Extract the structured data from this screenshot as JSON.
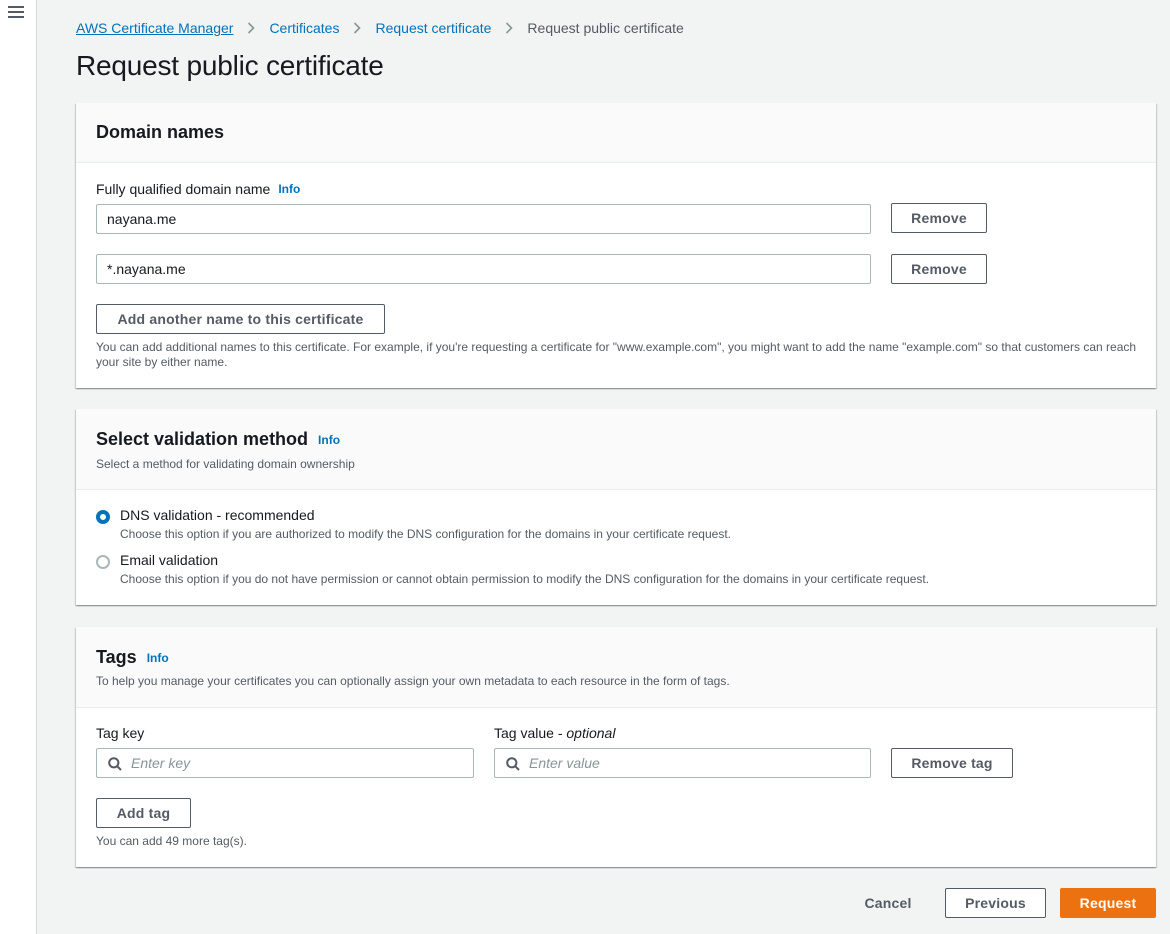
{
  "breadcrumb": {
    "items": [
      "AWS Certificate Manager",
      "Certificates",
      "Request certificate"
    ],
    "current": "Request public certificate"
  },
  "page": {
    "title": "Request public certificate"
  },
  "domain_names": {
    "title": "Domain names",
    "field_label": "Fully qualified domain name",
    "info": "Info",
    "values": [
      "nayana.me",
      "*.nayana.me"
    ],
    "remove_label": "Remove",
    "add_button": "Add another name to this certificate",
    "help_text": "You can add additional names to this certificate. For example, if you're requesting a certificate for \"www.example.com\", you might want to add the name \"example.com\" so that customers can reach your site by either name."
  },
  "validation": {
    "title": "Select validation method",
    "info": "Info",
    "description": "Select a method for validating domain ownership",
    "options": [
      {
        "label": "DNS validation - recommended",
        "description": "Choose this option if you are authorized to modify the DNS configuration for the domains in your certificate request.",
        "selected": true
      },
      {
        "label": "Email validation",
        "description": "Choose this option if you do not have permission or cannot obtain permission to modify the DNS configuration for the domains in your certificate request.",
        "selected": false
      }
    ]
  },
  "tags": {
    "title": "Tags",
    "info": "Info",
    "description": "To help you manage your certificates you can optionally assign your own metadata to each resource in the form of tags.",
    "key_label": "Tag key",
    "value_label": "Tag value",
    "value_optional": "optional",
    "key_placeholder": "Enter key",
    "value_placeholder": "Enter value",
    "remove_tag": "Remove tag",
    "add_tag": "Add tag",
    "remaining": "You can add 49 more tag(s)."
  },
  "footer": {
    "cancel": "Cancel",
    "previous": "Previous",
    "request": "Request"
  },
  "colors": {
    "primary": "#ec7211",
    "link": "#0073bb",
    "background": "#f2f3f3"
  }
}
